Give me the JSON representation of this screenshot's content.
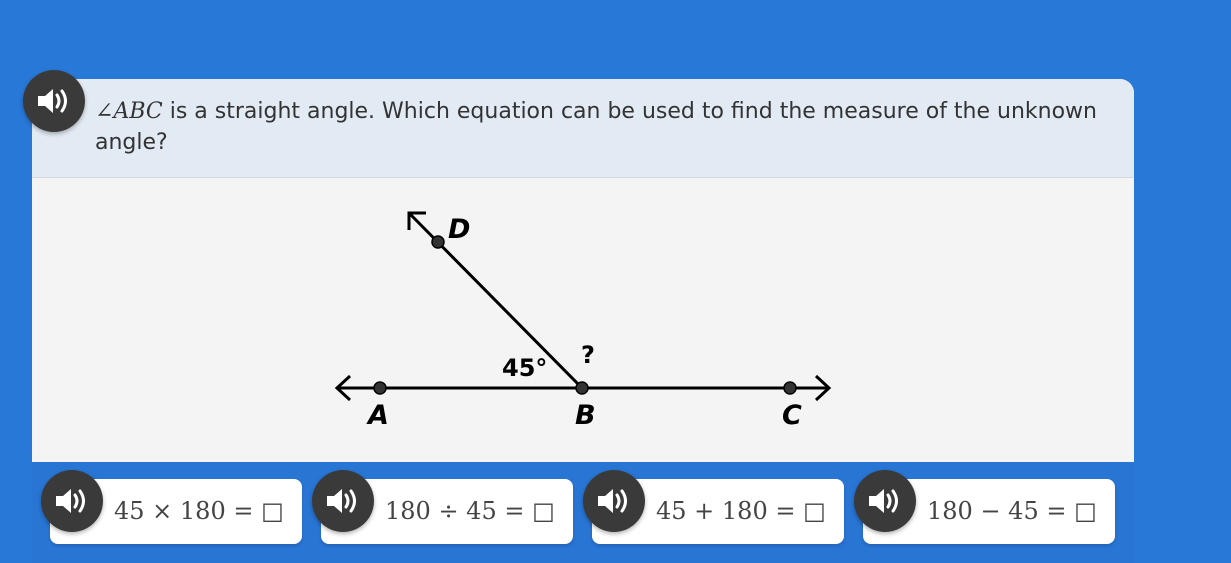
{
  "question": {
    "angle_symbol": "∠",
    "angle_name": "ABC",
    "text": " is a straight angle. Which equation can be used to find the measure of the unknown angle?"
  },
  "figure": {
    "labels": {
      "A": "A",
      "B": "B",
      "C": "C",
      "D": "D"
    },
    "known_angle": "45°",
    "unknown_angle": "?"
  },
  "answers": [
    {
      "equation": "45 × 180 = □"
    },
    {
      "equation": "180 ÷ 45 = □"
    },
    {
      "equation": "45 + 180 = □"
    },
    {
      "equation": "180 − 45 = □"
    }
  ],
  "icons": {
    "audio": "speaker-icon"
  },
  "colors": {
    "background": "#2878d8",
    "question_band": "#e2eaf4",
    "speaker": "#3a3a3a"
  }
}
